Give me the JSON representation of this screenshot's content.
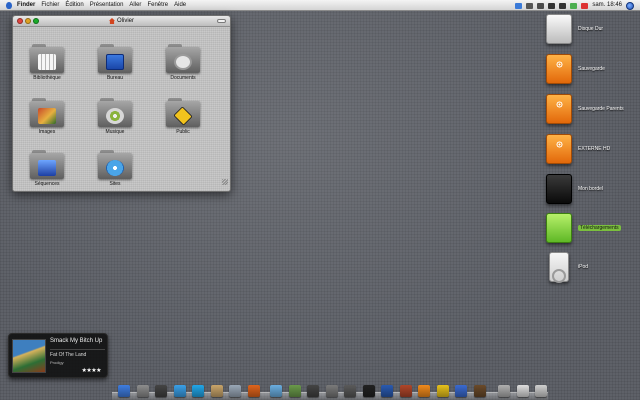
{
  "menubar": {
    "app": "Finder",
    "menus": [
      "Fichier",
      "Édition",
      "Présentation",
      "Aller",
      "Fenêtre",
      "Aide"
    ],
    "clock": "sam. 18:46"
  },
  "window": {
    "title": "Olivier",
    "items": [
      {
        "label": "Bibliothèque",
        "icon": "library-folder-icon"
      },
      {
        "label": "Bureau",
        "icon": "desktop-folder-icon"
      },
      {
        "label": "Documents",
        "icon": "documents-folder-icon"
      },
      {
        "label": "Images",
        "icon": "pictures-folder-icon"
      },
      {
        "label": "Musique",
        "icon": "music-folder-icon"
      },
      {
        "label": "Public",
        "icon": "public-folder-icon"
      },
      {
        "label": "Séquences",
        "icon": "movies-folder-icon"
      },
      {
        "label": "Sites",
        "icon": "sites-folder-icon"
      }
    ]
  },
  "desktop": {
    "items": [
      {
        "label": "Disque Dur",
        "icon": "hard-drive-icon",
        "color": "#e0e0e0"
      },
      {
        "label": "Sauvegarde",
        "icon": "external-drive-icon",
        "color": "#f28a1e"
      },
      {
        "label": "Sauvegarde Parents",
        "icon": "external-drive-icon",
        "color": "#f28a1e"
      },
      {
        "label": "EXTERNE HD",
        "icon": "external-drive-icon",
        "color": "#f28a1e"
      },
      {
        "label": "Mon bordel",
        "icon": "folder-icon",
        "color": "#111111"
      },
      {
        "label": "Téléchargements",
        "icon": "downloads-folder-icon",
        "color": "#7bbf3e",
        "selected": true
      },
      {
        "label": "iPod",
        "icon": "ipod-icon",
        "color": "#e6e6e6"
      }
    ]
  },
  "itunes_widget": {
    "track": "Smack My Bitch Up",
    "album": "Fat Of The Land",
    "artist": "Prodigy",
    "rating": "★★★★"
  },
  "dock": {
    "items": [
      {
        "icon": "finder-icon",
        "color": "#3f7de0"
      },
      {
        "icon": "system-preferences-icon",
        "color": "#8d8d8d"
      },
      {
        "icon": "dashboard-icon",
        "color": "#444444"
      },
      {
        "icon": "ichat-icon",
        "color": "#3aa0e8"
      },
      {
        "icon": "skype-icon",
        "color": "#22a6e8"
      },
      {
        "icon": "address-book-icon",
        "color": "#c9a56a"
      },
      {
        "icon": "mail-icon",
        "color": "#9aa8b8"
      },
      {
        "icon": "firefox-icon",
        "color": "#e0641c"
      },
      {
        "icon": "itunes-icon",
        "color": "#6aaee0"
      },
      {
        "icon": "iphoto-icon",
        "color": "#6a9a4a"
      },
      {
        "icon": "imovie-icon",
        "color": "#444444"
      },
      {
        "icon": "preview-icon",
        "color": "#7a7a7a"
      },
      {
        "icon": "text-editor-icon",
        "color": "#5a5a5a"
      },
      {
        "icon": "terminal-icon",
        "color": "#222222"
      },
      {
        "icon": "quicktime-icon",
        "color": "#2a5ab0"
      },
      {
        "icon": "games-icon",
        "color": "#b0462a"
      },
      {
        "icon": "vlc-icon",
        "color": "#f08a1c"
      },
      {
        "icon": "cyberduck-icon",
        "color": "#e8c21c"
      },
      {
        "icon": "transmission-icon",
        "color": "#3a6ad0"
      },
      {
        "icon": "app-icon",
        "color": "#6a4a2a"
      },
      {
        "icon": "downloads-stack-icon",
        "color": "#b0b0b0"
      },
      {
        "icon": "documents-stack-icon",
        "color": "#dddddd"
      },
      {
        "icon": "trash-icon",
        "color": "#cfcfcf"
      }
    ]
  }
}
